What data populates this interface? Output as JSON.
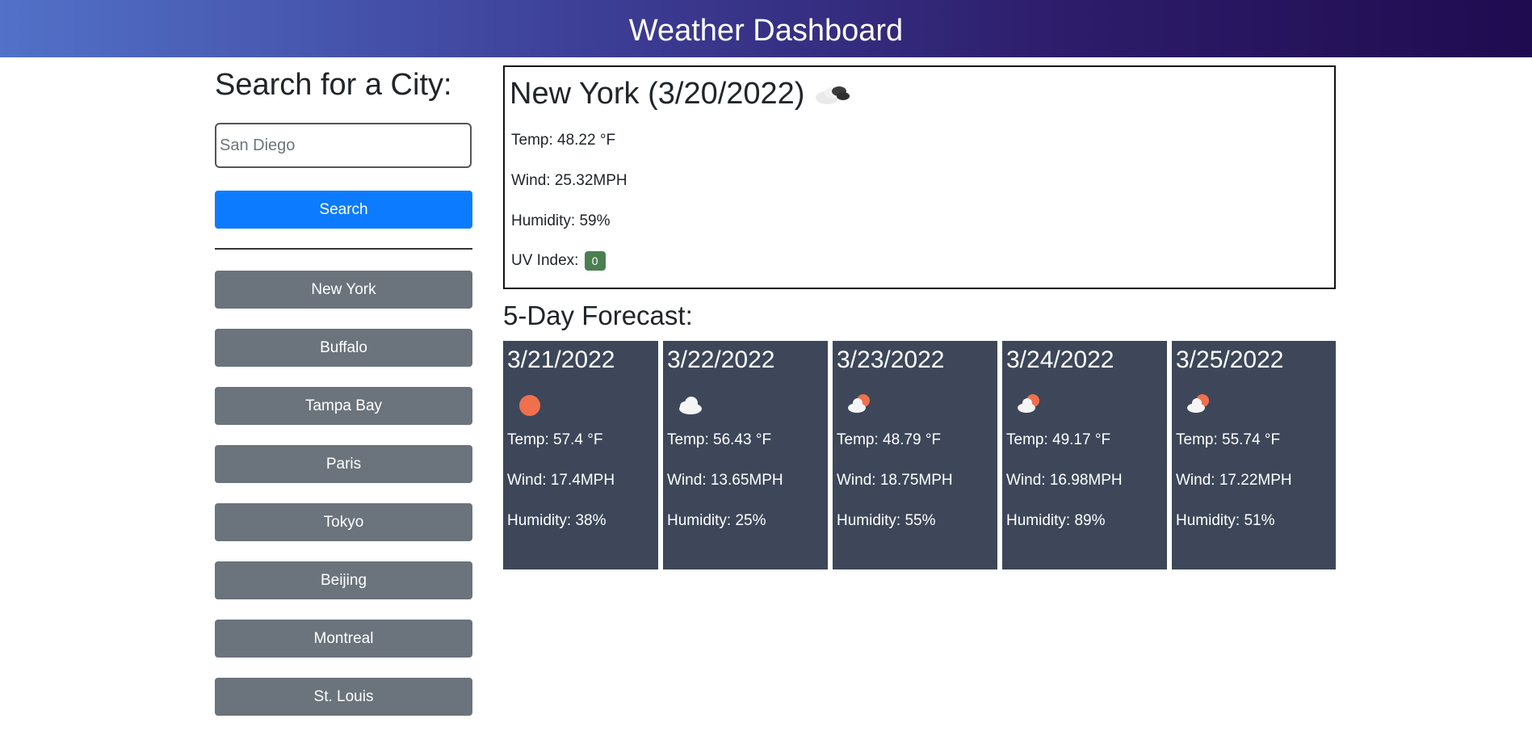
{
  "header": {
    "title": "Weather Dashboard"
  },
  "search": {
    "title": "Search for a City:",
    "placeholder": "San Diego",
    "button_label": "Search"
  },
  "history": [
    {
      "label": "New York"
    },
    {
      "label": "Buffalo"
    },
    {
      "label": "Tampa Bay"
    },
    {
      "label": "Paris"
    },
    {
      "label": "Tokyo"
    },
    {
      "label": "Beijing"
    },
    {
      "label": "Montreal"
    },
    {
      "label": "St. Louis"
    }
  ],
  "current": {
    "title": "New York (3/20/2022)",
    "icon": "broken-clouds-icon",
    "temp": "Temp: 48.22 °F",
    "wind": "Wind: 25.32MPH",
    "humidity": "Humidity: 59%",
    "uv_label": "UV Index:",
    "uv_value": "0",
    "uv_color": "#4b7f52"
  },
  "forecast_title": "5-Day Forecast:",
  "forecast": [
    {
      "date": "3/21/2022",
      "icon": "clear-sun-icon",
      "temp": "Temp: 57.4 °F",
      "wind": "Wind: 17.4MPH",
      "humidity": "Humidity: 38%"
    },
    {
      "date": "3/22/2022",
      "icon": "cloud-icon",
      "temp": "Temp: 56.43 °F",
      "wind": "Wind: 13.65MPH",
      "humidity": "Humidity: 25%"
    },
    {
      "date": "3/23/2022",
      "icon": "partly-cloudy-icon",
      "temp": "Temp: 48.79 °F",
      "wind": "Wind: 18.75MPH",
      "humidity": "Humidity: 55%"
    },
    {
      "date": "3/24/2022",
      "icon": "partly-cloudy-icon",
      "temp": "Temp: 49.17 °F",
      "wind": "Wind: 16.98MPH",
      "humidity": "Humidity: 89%"
    },
    {
      "date": "3/25/2022",
      "icon": "partly-cloudy-icon",
      "temp": "Temp: 55.74 °F",
      "wind": "Wind: 17.22MPH",
      "humidity": "Humidity: 51%"
    }
  ],
  "colors": {
    "header_gradient_start": "#5271c8",
    "header_gradient_end": "#1f0b4f",
    "search_button": "#0d7bff",
    "history_button": "#6b737c",
    "forecast_card": "#3d4759",
    "sun": "#f0704d"
  }
}
